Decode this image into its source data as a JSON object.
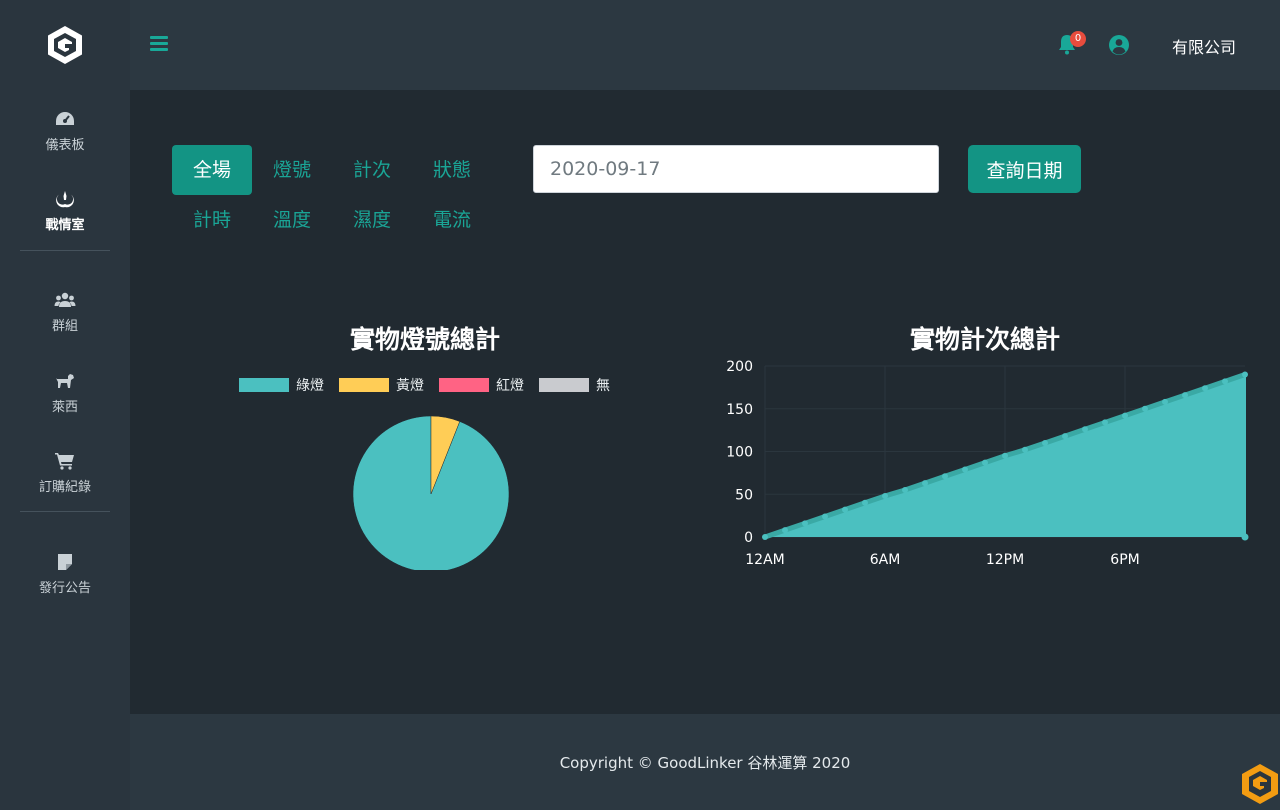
{
  "sidebar": {
    "items": [
      {
        "label": "儀表板",
        "icon": "dashboard-icon"
      },
      {
        "label": "戰情室",
        "icon": "jedi-icon"
      },
      {
        "label": "群組",
        "icon": "users-icon"
      },
      {
        "label": "萊西",
        "icon": "dog-icon"
      },
      {
        "label": "訂購紀錄",
        "icon": "cart-icon"
      },
      {
        "label": "發行公告",
        "icon": "sticky-note-icon"
      }
    ]
  },
  "header": {
    "notification_count": "0",
    "company_name": "有限公司"
  },
  "tabs": [
    {
      "label": "全場",
      "active": true
    },
    {
      "label": "燈號"
    },
    {
      "label": "計次"
    },
    {
      "label": "狀態"
    },
    {
      "label": "計時"
    },
    {
      "label": "溫度"
    },
    {
      "label": "濕度"
    },
    {
      "label": "電流"
    }
  ],
  "date_filter": {
    "value": "2020-09-17",
    "button_label": "查詢日期"
  },
  "colors": {
    "accent": "#139484",
    "teal": "#4bc0c0",
    "yellow": "#ffcd56",
    "red": "#ff6384",
    "gray": "#c9cbcf"
  },
  "chart_data": [
    {
      "type": "pie",
      "title": "實物燈號總計",
      "legend": [
        {
          "name": "綠燈",
          "color": "#4bc0c0"
        },
        {
          "name": "黃燈",
          "color": "#ffcd56"
        },
        {
          "name": "紅燈",
          "color": "#ff6384"
        },
        {
          "name": "無",
          "color": "#c9cbcf"
        }
      ],
      "values": [
        94,
        6,
        0,
        0
      ]
    },
    {
      "type": "area",
      "title": "實物計次總計",
      "x_ticks": [
        "12AM",
        "6AM",
        "12PM",
        "6PM"
      ],
      "y_ticks": [
        0,
        50,
        100,
        150,
        200
      ],
      "ylim": [
        0,
        200
      ],
      "x": [
        0,
        1,
        2,
        3,
        4,
        5,
        6,
        7,
        8,
        9,
        10,
        11,
        12,
        13,
        14,
        15,
        16,
        17,
        18,
        19,
        20,
        21,
        22,
        23,
        24
      ],
      "values": [
        0,
        8,
        16,
        24,
        32,
        40,
        48,
        55,
        63,
        71,
        79,
        87,
        95,
        102,
        110,
        118,
        126,
        134,
        142,
        150,
        158,
        166,
        174,
        182,
        190
      ],
      "end_marker": [
        24,
        0
      ],
      "grid": true
    }
  ],
  "footer": {
    "text": "Copyright © GoodLinker 谷林運算 2020"
  }
}
